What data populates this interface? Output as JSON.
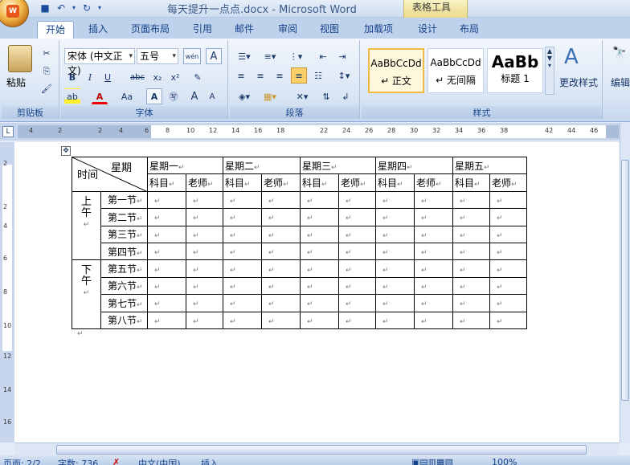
{
  "window": {
    "title": "每天提升一点点.docx - Microsoft Word",
    "context_tab_group": "表格工具"
  },
  "tabs": [
    "开始",
    "插入",
    "页面布局",
    "引用",
    "邮件",
    "审阅",
    "视图",
    "加载项",
    "设计",
    "布局"
  ],
  "ribbon": {
    "clipboard": {
      "label": "剪贴板",
      "paste": "粘贴"
    },
    "font": {
      "label": "字体",
      "font_name": "宋体 (中文正文)",
      "font_size": "五号",
      "bold": "B",
      "italic": "I",
      "underline": "U",
      "strike": "abc",
      "sub": "x₂",
      "sup": "x²",
      "aa": "Aa",
      "grow": "A",
      "shrink": "A",
      "char_border": "A",
      "phonetic": "wén"
    },
    "paragraph": {
      "label": "段落"
    },
    "styles": {
      "label": "样式",
      "items": [
        {
          "preview": "AaBbCcDd",
          "name": "↵ 正文"
        },
        {
          "preview": "AaBbCcDd",
          "name": "↵ 无间隔"
        },
        {
          "preview": "AaBb",
          "name": "标题 1"
        }
      ],
      "change": "更改样式"
    },
    "editing": {
      "label": "编辑"
    }
  },
  "ruler": {
    "h_numbers": [
      "4",
      "2",
      "2",
      "4",
      "6",
      "8",
      "10",
      "12",
      "14",
      "16",
      "18",
      "22",
      "24",
      "26",
      "28",
      "30",
      "32",
      "34",
      "36",
      "38",
      "42",
      "44",
      "46"
    ],
    "v_numbers": [
      "2",
      "2",
      "4",
      "6",
      "8",
      "10",
      "12",
      "14",
      "16"
    ]
  },
  "table": {
    "corner_top": "星期",
    "corner_bottom": "时间",
    "days": [
      "星期一",
      "星期二",
      "星期三",
      "星期四",
      "星期五"
    ],
    "sub_headers": [
      "科目",
      "老师"
    ],
    "morning": "上午",
    "afternoon": "下午",
    "periods": [
      "第一节",
      "第二节",
      "第三节",
      "第四节",
      "第五节",
      "第六节",
      "第七节",
      "第八节"
    ],
    "mark": "↵"
  },
  "status": {
    "page": "页面: 2/2",
    "words": "字数: 736",
    "language": "中文(中国)",
    "mode": "插入",
    "zoom": "100%"
  }
}
